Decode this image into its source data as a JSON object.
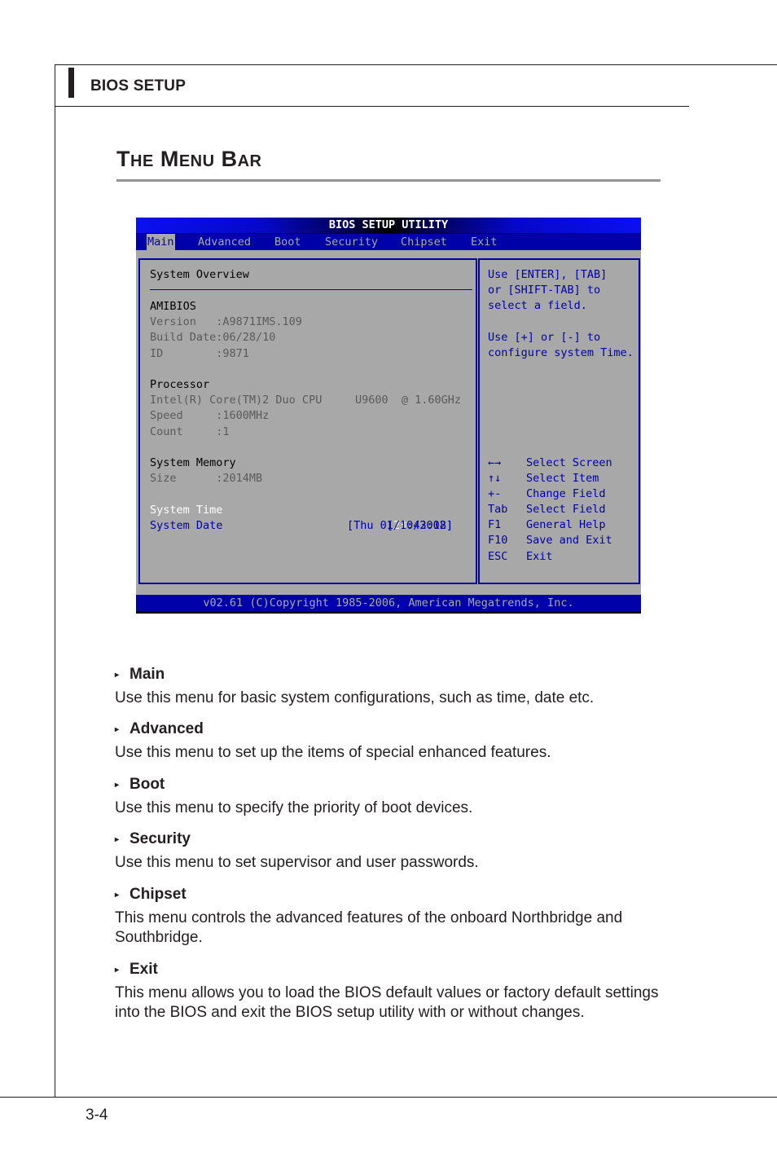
{
  "header": {
    "section_label": "BIOS SETUP"
  },
  "title": {
    "first_cap": "T",
    "first_rest": "HE",
    "second_cap": "M",
    "second_rest": "ENU",
    "third_cap": "B",
    "third_rest": "AR",
    "full": "The Menu Bar"
  },
  "bios": {
    "title": "BIOS SETUP UTILITY",
    "menu": [
      {
        "label": "Main",
        "active": true
      },
      {
        "label": "Advanced",
        "active": false
      },
      {
        "label": "Boot",
        "active": false
      },
      {
        "label": "Security",
        "active": false
      },
      {
        "label": "Chipset",
        "active": false
      },
      {
        "label": "Exit",
        "active": false
      }
    ],
    "overview_heading": "System Overview",
    "amibios": {
      "heading": "AMIBIOS",
      "version": "Version   :A9871IMS.109",
      "build_date": "Build Date:06/28/10",
      "id": "ID        :9871"
    },
    "processor": {
      "heading": "Processor",
      "name": "Intel(R) Core(TM)2 Duo CPU     U9600  @ 1.60GHz",
      "speed": "Speed     :1600MHz",
      "count": "Count     :1"
    },
    "memory": {
      "heading": "System Memory",
      "size": "Size      :2014MB"
    },
    "system_time": {
      "label": "System Time",
      "open": "[",
      "hours": "23",
      "rest": ":43:18]"
    },
    "system_date": {
      "label": "System Date",
      "value": "[Thu 01/10/2002]"
    },
    "help": [
      "Use [ENTER], [TAB]",
      "or [SHIFT-TAB] to",
      "select a field.",
      "",
      "Use [+] or [-] to",
      "configure system Time."
    ],
    "keys": [
      {
        "key": "←→",
        "action": "Select Screen"
      },
      {
        "key": "↑↓",
        "action": "Select Item"
      },
      {
        "key": "+-",
        "action": "Change Field"
      },
      {
        "key": "Tab",
        "action": "Select Field"
      },
      {
        "key": "F1",
        "action": "General Help"
      },
      {
        "key": "F10",
        "action": "Save and Exit"
      },
      {
        "key": "ESC",
        "action": "Exit"
      }
    ],
    "footer": "v02.61 (C)Copyright 1985-2006, American Megatrends, Inc.",
    "colors": {
      "background": "#a8a8a8",
      "menu_bar": "#0000a8",
      "accent": "#0000a8"
    }
  },
  "descriptions": [
    {
      "arrow": "▸",
      "name": "Main",
      "text": "Use this menu for basic system configurations, such as time, date etc."
    },
    {
      "arrow": "▸",
      "name": "Advanced",
      "text": "Use this menu to set up the items of special enhanced features."
    },
    {
      "arrow": "▸",
      "name": "Boot",
      "text": "Use this menu to specify the priority of boot devices."
    },
    {
      "arrow": "▸",
      "name": "Security",
      "text": "Use this menu to set supervisor and user passwords."
    },
    {
      "arrow": "▸",
      "name": "Chipset",
      "text": "This menu controls the advanced features of the onboard Northbridge and Southbridge."
    },
    {
      "arrow": "▸",
      "name": "Exit",
      "text": "This menu allows you to load the BIOS default values or factory default settings into the BIOS and exit the BIOS setup utility with or without changes."
    }
  ],
  "footer": {
    "page_number": "3-4"
  }
}
